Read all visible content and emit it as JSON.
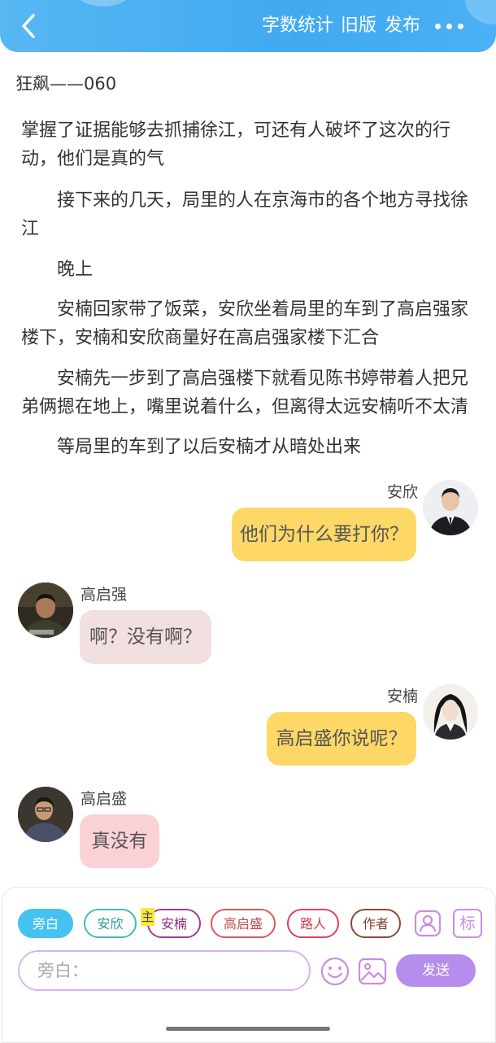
{
  "header": {
    "stats_label": "字数统计",
    "old_version_label": "旧版",
    "publish_label": "发布"
  },
  "chapter": {
    "title": "狂飙——060"
  },
  "narration": [
    "掌握了证据能够去抓捕徐江，可还有人破坏了这次的行动，他们是真的气",
    "　　接下来的几天，局里的人在京海市的各个地方寻找徐江",
    "　　晚上",
    "　　安楠回家带了饭菜，安欣坐着局里的车到了高启强家楼下，安楠和安欣商量好在高启强家楼下汇合",
    "　　安楠先一步到了高启强楼下就看见陈书婷带着人把兄弟俩摁在地上，嘴里说着什么，但离得太远安楠听不太清",
    "　　等局里的车到了以后安楠才从暗处出来"
  ],
  "messages": [
    {
      "speaker": "安欣",
      "text": "他们为什么要打你？",
      "side": "right"
    },
    {
      "speaker": "高启强",
      "text": "啊？没有啊？",
      "side": "left"
    },
    {
      "speaker": "安楠",
      "text": "高启盛你说呢？",
      "side": "right"
    },
    {
      "speaker": "高启盛",
      "text": "真没有",
      "side": "left"
    }
  ],
  "composer": {
    "roles": [
      {
        "label": "旁白",
        "color": "#45c3f0",
        "active": true
      },
      {
        "label": "安欣",
        "color": "#3fbcb8"
      },
      {
        "label": "安楠",
        "color": "#a63a9e",
        "badge": "主"
      },
      {
        "label": "高启盛",
        "color": "#d85a5a"
      },
      {
        "label": "路人",
        "color": "#e0405a"
      },
      {
        "label": "作者",
        "color": "#8a4a36"
      }
    ],
    "input_placeholder": "旁白：",
    "send_label": "发送",
    "tag_icon_label": "标"
  },
  "colors": {
    "header": "#4aaef2",
    "bubble_right": "#fdd867",
    "bubble_gaoqiqiang": "#f2dfe0",
    "bubble_gaoqisheng": "#fbd1d8",
    "send": "#b48ded",
    "accent_purple": "#c98ee0"
  }
}
